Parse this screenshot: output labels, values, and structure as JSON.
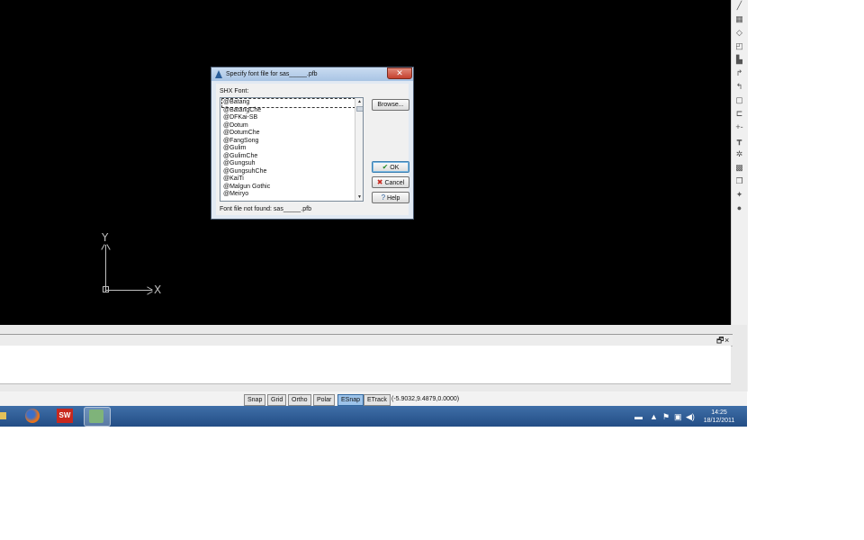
{
  "dialog": {
    "title": "Specify font file for sas_____.pfb",
    "close_icon": "close-icon",
    "shx_label": "SHX Font:",
    "fonts": [
      "@Batang",
      "@BatangChe",
      "@DFKai-SB",
      "@Dotum",
      "@DotumChe",
      "@FangSong",
      "@Gulim",
      "@GulimChe",
      "@Gungsuh",
      "@GungsuhChe",
      "@KaiTi",
      "@Malgun Gothic",
      "@Meiryo"
    ],
    "selected_font": "@Batang",
    "browse_label": "Browse...",
    "ok_label": "OK",
    "cancel_label": "Cancel",
    "help_label": "Help",
    "status_text": "Font file not found: sas_____.pfb"
  },
  "ucs": {
    "y_label": "Y",
    "x_label": "X"
  },
  "statusbar": {
    "toggles": [
      {
        "label": "Snap",
        "active": false
      },
      {
        "label": "Grid",
        "active": false
      },
      {
        "label": "Ortho",
        "active": false
      },
      {
        "label": "Polar",
        "active": false
      },
      {
        "label": "ESnap",
        "active": true
      },
      {
        "label": "ETrack",
        "active": false
      }
    ],
    "coordinates": "(-5.9032,9.4879,0.0000)"
  },
  "command_window": {
    "restore_glyph": "🗗",
    "close_glyph": "×"
  },
  "taskbar": {
    "apps": [
      "windows-explorer-icon",
      "firefox-icon",
      "solidworks-icon",
      "cad-app-icon"
    ],
    "time": "14:25",
    "date": "18/12/2011"
  },
  "colors": {
    "canvas": "#000000",
    "taskbar": "#2b5a96",
    "active_toggle": "#9cc3ea"
  }
}
